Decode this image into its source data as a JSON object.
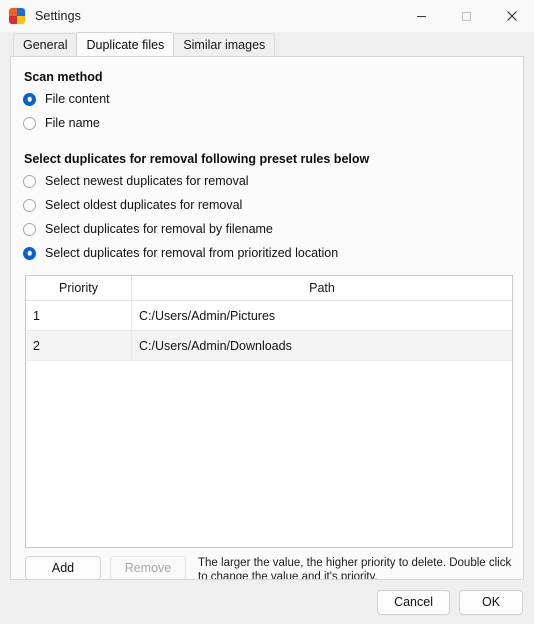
{
  "window": {
    "title": "Settings",
    "icon": "app-logo-icon",
    "controls": {
      "minimize": "minimize-icon",
      "maximize": "maximize-icon",
      "close": "close-icon"
    }
  },
  "tabs": [
    {
      "label": "General",
      "active": false
    },
    {
      "label": "Duplicate files",
      "active": true
    },
    {
      "label": "Similar images",
      "active": false
    }
  ],
  "scan_method": {
    "heading": "Scan method",
    "options": [
      {
        "label": "File content",
        "checked": true
      },
      {
        "label": "File name",
        "checked": false
      }
    ]
  },
  "preset_rules": {
    "heading": "Select duplicates for removal following preset rules below",
    "options": [
      {
        "label": "Select newest duplicates for removal",
        "checked": false
      },
      {
        "label": "Select oldest duplicates for removal",
        "checked": false
      },
      {
        "label": "Select duplicates for removal by filename",
        "checked": false
      },
      {
        "label": "Select duplicates for removal from prioritized location",
        "checked": true
      }
    ]
  },
  "priority_table": {
    "columns": [
      "Priority",
      "Path"
    ],
    "rows": [
      {
        "priority": "1",
        "path": "C:/Users/Admin/Pictures"
      },
      {
        "priority": "2",
        "path": "C:/Users/Admin/Downloads"
      }
    ]
  },
  "actions": {
    "add_label": "Add",
    "remove_label": "Remove",
    "remove_disabled": true,
    "hint": "The larger the value, the higher priority to delete. Double click to change the value and it's priority."
  },
  "footer": {
    "cancel_label": "Cancel",
    "ok_label": "OK"
  },
  "colors": {
    "accent": "#0a62c7",
    "window_bg": "#efefef",
    "panel_bg": "#fbfbfb",
    "alt_row": "#f4f4f4"
  }
}
